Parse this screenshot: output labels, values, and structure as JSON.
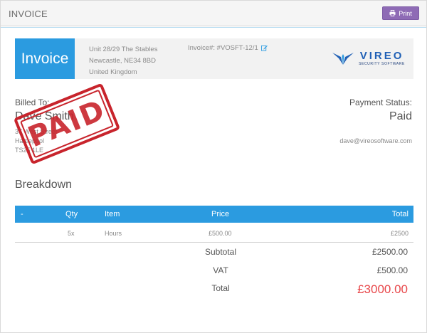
{
  "topbar": {
    "title": "INVOICE",
    "print_label": "Print"
  },
  "header": {
    "tile_label": "Invoice",
    "address_lines": [
      "Unit 28/29 The Stables",
      "Newcastle, NE34 8BD",
      "United Kingdom"
    ],
    "invoice_number": "Invoice#: #VOSFT-12/1",
    "logo": {
      "name": "VIREO",
      "tagline": "SECURITY SOFTWARE"
    }
  },
  "billed": {
    "label": "Billed To:",
    "name": "Dave Smith",
    "address_lines": [
      "37 West Street",
      "Hartlepool",
      "TS25 1LE"
    ]
  },
  "stamp": {
    "text": "PAID",
    "color": "#c8242c"
  },
  "payment": {
    "label": "Payment Status:",
    "status": "Paid",
    "email": "dave@vireosoftware.com"
  },
  "breakdown": {
    "title": "Breakdown",
    "columns": {
      "index": "-",
      "qty": "Qty",
      "item": "Item",
      "price": "Price",
      "total": "Total"
    },
    "rows": [
      {
        "qty": "5x",
        "item": "Hours",
        "price": "£500.00",
        "total": "£2500"
      }
    ]
  },
  "summary": {
    "subtotal_label": "Subtotal",
    "subtotal": "£2500.00",
    "vat_label": "VAT",
    "vat": "£500.00",
    "total_label": "Total",
    "total": "£3000.00"
  },
  "colors": {
    "accent": "#2b9be0",
    "print_button": "#8e6bb5",
    "total": "#e8474a"
  }
}
